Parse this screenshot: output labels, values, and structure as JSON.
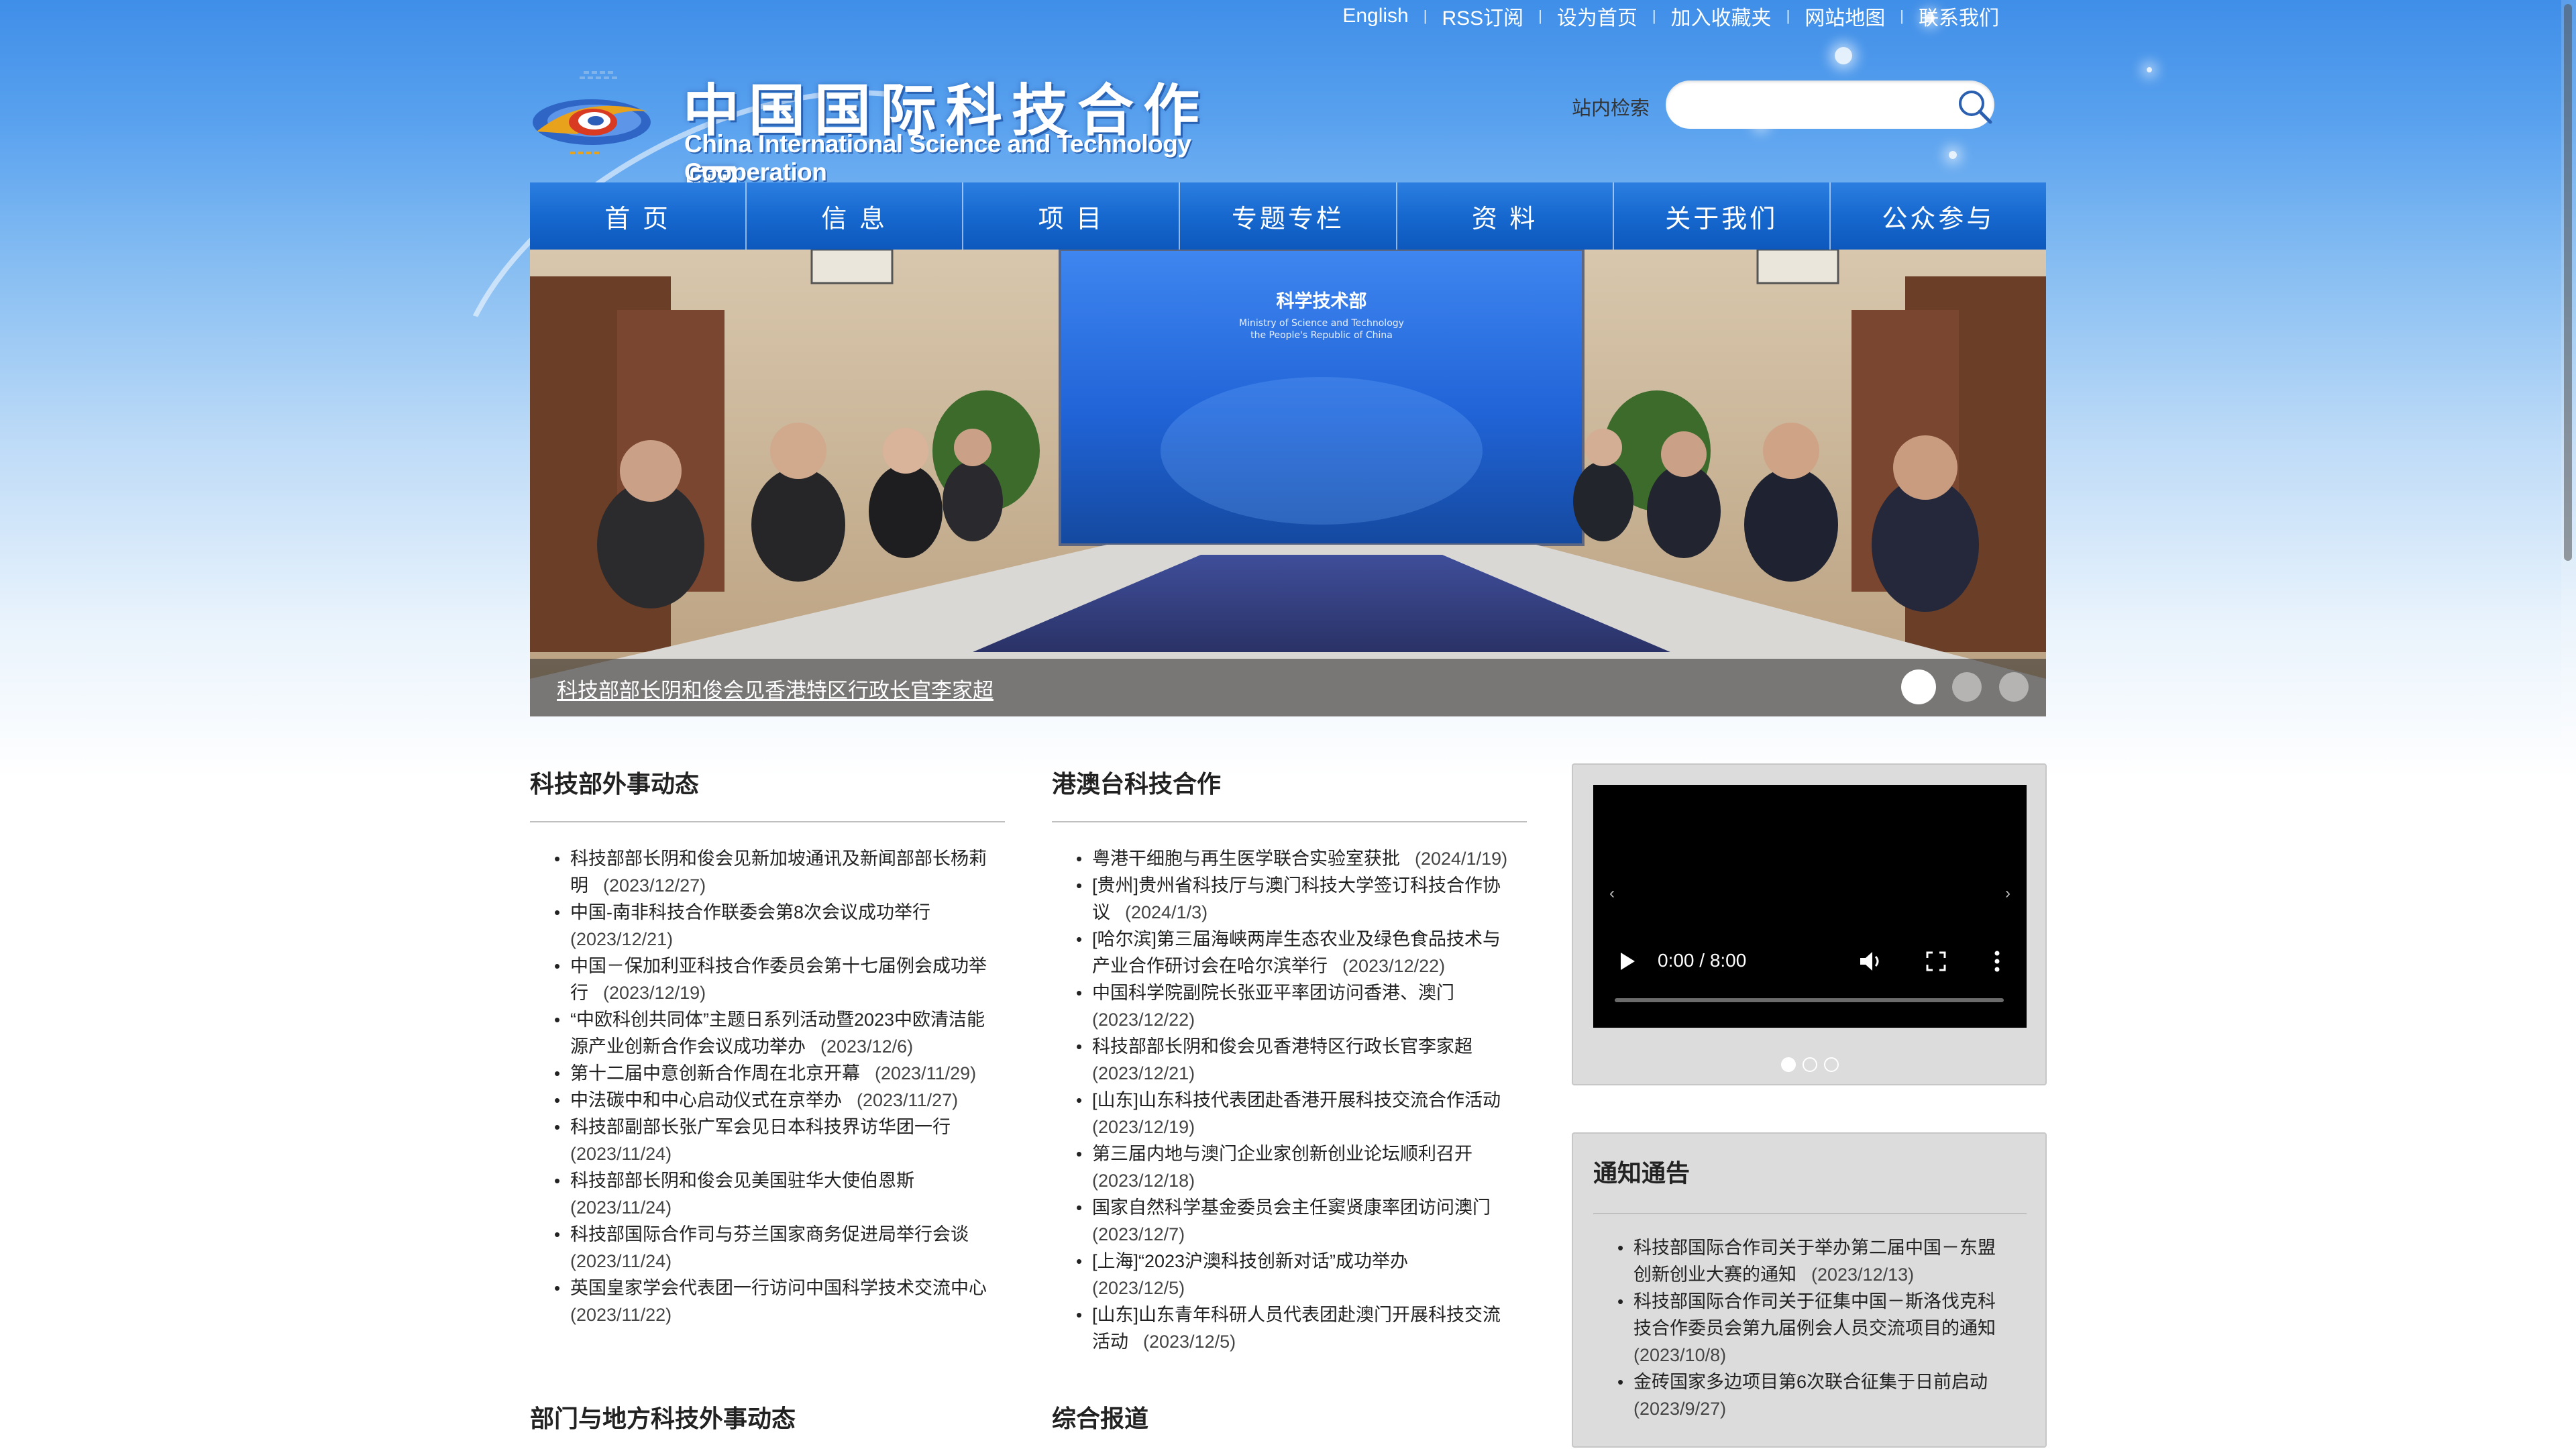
{
  "toplinks": [
    "English",
    "RSS订阅",
    "设为首页",
    "加入收藏夹",
    "网站地图",
    "联系我们"
  ],
  "logo": {
    "cn": "中国国际科技合作网",
    "en": "China International Science and Technology Cooperation"
  },
  "search": {
    "label": "站内检索",
    "value": ""
  },
  "nav": [
    "首 页",
    "信 息",
    "项 目",
    "专题专栏",
    "资 料",
    "关于我们",
    "公众参与"
  ],
  "hero": {
    "caption": "科技部部长阴和俊会见香港特区行政长官李家超",
    "screen_title": "科学技术部",
    "screen_sub1": "Ministry of Science and Technology",
    "screen_sub2": "the People's Republic of China",
    "slides_total": 3,
    "slide_active": 1
  },
  "col1": {
    "title": "科技部外事动态",
    "items": [
      {
        "t": "科技部部长阴和俊会见新加坡通讯及新闻部部长杨莉",
        "t2": "明",
        "d": "(2023/12/27)"
      },
      {
        "t": "中国-南非科技合作联委会第8次会议成功举行",
        "t2": "",
        "d": "(2023/12/21)"
      },
      {
        "t": "中国－保加利亚科技合作委员会第十七届例会成功举",
        "t2": "行",
        "d": "(2023/12/19)"
      },
      {
        "t": "“中欧科创共同体”主题日系列活动暨2023中欧清洁能",
        "t2": "源产业创新合作会议成功举办",
        "d": "(2023/12/6)"
      },
      {
        "t": "第十二届中意创新合作周在北京开幕",
        "t2": "",
        "d": "(2023/11/29)"
      },
      {
        "t": "中法碳中和中心启动仪式在京举办",
        "t2": "",
        "d": "(2023/11/27)"
      },
      {
        "t": "科技部副部长张广军会见日本科技界访华团一行",
        "t2": "",
        "d": "(2023/11/24)"
      },
      {
        "t": "科技部部长阴和俊会见美国驻华大使伯恩斯",
        "t2": "",
        "d": "(2023/11/24)"
      },
      {
        "t": "科技部国际合作司与芬兰国家商务促进局举行会谈",
        "t2": "",
        "d": "(2023/11/24)"
      },
      {
        "t": "英国皇家学会代表团一行访问中国科学技术交流中心",
        "t2": "",
        "d": "(2023/11/22)"
      }
    ]
  },
  "col2": {
    "title": "港澳台科技合作",
    "items": [
      {
        "t": "粤港干细胞与再生医学联合实验室获批",
        "t2": "",
        "d": "(2024/1/19)"
      },
      {
        "t": "[贵州]贵州省科技厅与澳门科技大学签订科技合作协",
        "t2": "议",
        "d": "(2024/1/3)"
      },
      {
        "t": "[哈尔滨]第三届海峡两岸生态农业及绿色食品技术与",
        "t2": "产业合作研讨会在哈尔滨举行",
        "d": "(2023/12/22)"
      },
      {
        "t": "中国科学院副院长张亚平率团访问香港、澳门",
        "t2": "",
        "d": "(2023/12/22)"
      },
      {
        "t": "科技部部长阴和俊会见香港特区行政长官李家超",
        "t2": "",
        "d": "(2023/12/21)"
      },
      {
        "t": "[山东]山东科技代表团赴香港开展科技交流合作活动",
        "t2": "",
        "d": "(2023/12/19)"
      },
      {
        "t": "第三届内地与澳门企业家创新创业论坛顺利召开",
        "t2": "",
        "d": "(2023/12/18)"
      },
      {
        "t": "国家自然科学基金委员会主任窦贤康率团访问澳门",
        "t2": "",
        "d": "(2023/12/7)"
      },
      {
        "t": "[上海]“2023沪澳科技创新对话”成功举办",
        "t2": "",
        "d": "(2023/12/5)"
      },
      {
        "t": "[山东]山东青年科研人员代表团赴澳门开展科技交流",
        "t2": "活动",
        "d": "(2023/12/5)"
      }
    ]
  },
  "video": {
    "time": "0:00 / 8:00",
    "slides_total": 3,
    "slide_active": 1
  },
  "notice": {
    "title": "通知通告",
    "items": [
      {
        "t": "科技部国际合作司关于举办第二届中国－东盟",
        "t2": "创新创业大赛的通知",
        "d": "(2023/12/13)"
      },
      {
        "t": "科技部国际合作司关于征集中国－斯洛伐克科",
        "t2": "技合作委员会第九届例会人员交流项目的通知",
        "d": "(2023/10/8)"
      },
      {
        "t": "金砖国家多边项目第6次联合征集于日前启动",
        "t2": "",
        "d": "(2023/9/27)"
      }
    ]
  },
  "bottom": {
    "left_title": "部门与地方科技外事动态",
    "mid_title": "综合报道"
  },
  "colors": {
    "nav_blue": "#1668cf",
    "sky_blue": "#3f8ee8"
  }
}
